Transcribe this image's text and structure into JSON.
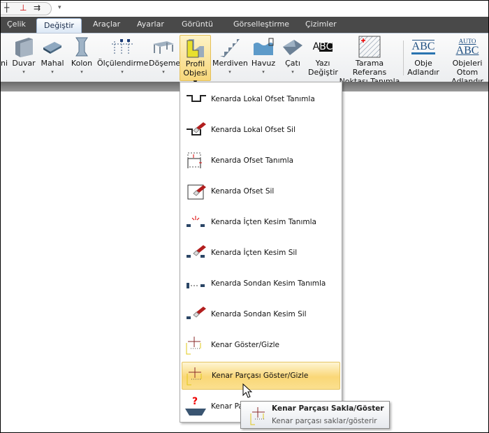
{
  "quick_access": {
    "icons": [
      "beam-icon",
      "column-red-icon",
      "arrows-icon"
    ],
    "dropdown": "▾"
  },
  "tabs": [
    {
      "label": "Çelik"
    },
    {
      "label": "Değiştir",
      "active": true
    },
    {
      "label": "Araçlar"
    },
    {
      "label": "Ayarlar"
    },
    {
      "label": "Görüntü"
    },
    {
      "label": "Görselleştirme"
    },
    {
      "label": "Çizimler"
    }
  ],
  "ribbon": [
    {
      "l1": "ni",
      "l2": ""
    },
    {
      "l1": "Duvar",
      "l2": "▾"
    },
    {
      "l1": "Mahal",
      "l2": "▾"
    },
    {
      "l1": "Kolon",
      "l2": "▾"
    },
    {
      "l1": "Ölçülendirme",
      "l2": "▾"
    },
    {
      "l1": "Döşeme",
      "l2": "▾"
    },
    {
      "l1": "Profil",
      "l2": "Objesi ▾"
    },
    {
      "l1": "Merdiven",
      "l2": "▾"
    },
    {
      "l1": "Havuz",
      "l2": "▾"
    },
    {
      "l1": "Çatı",
      "l2": "▾"
    },
    {
      "l1": "Yazı",
      "l2": "Değiştir"
    },
    {
      "l1": "Tarama Referans",
      "l2": "Noktası Tanımla"
    },
    {
      "l1": "Obje",
      "l2": "Adlandır"
    },
    {
      "l1": "Objeleri Otom",
      "l2": "Adlandır"
    }
  ],
  "ribbon_icon_text": {
    "abc": "ABC",
    "auto": "AUTO",
    "abc_box": "A",
    "abc_box2": "BC"
  },
  "menu": [
    {
      "label": "Kenarda Lokal Ofset Tanımla"
    },
    {
      "label": "Kenarda Lokal Ofset Sil"
    },
    {
      "label": "Kenarda Ofset Tanımla"
    },
    {
      "label": "Kenarda Ofset Sil"
    },
    {
      "label": "Kenarda İçten Kesim Tanımla"
    },
    {
      "label": "Kenarda İçten Kesim Sil"
    },
    {
      "label": "Kenarda Sondan Kesim Tanımla"
    },
    {
      "label": "Kenarda Sondan Kesim Sil"
    },
    {
      "label": "Kenar Göster/Gizle"
    },
    {
      "label": "Kenar Parçası Göster/Gizle",
      "hover": true
    },
    {
      "label": "Kenar Pa"
    }
  ],
  "tooltip": {
    "title": "Kenar Parçası Sakla/Göster",
    "desc": "Kenar parçası saklar/gösterir"
  },
  "colors": {
    "tabbar": "#494949",
    "highlight": "#fad777"
  }
}
